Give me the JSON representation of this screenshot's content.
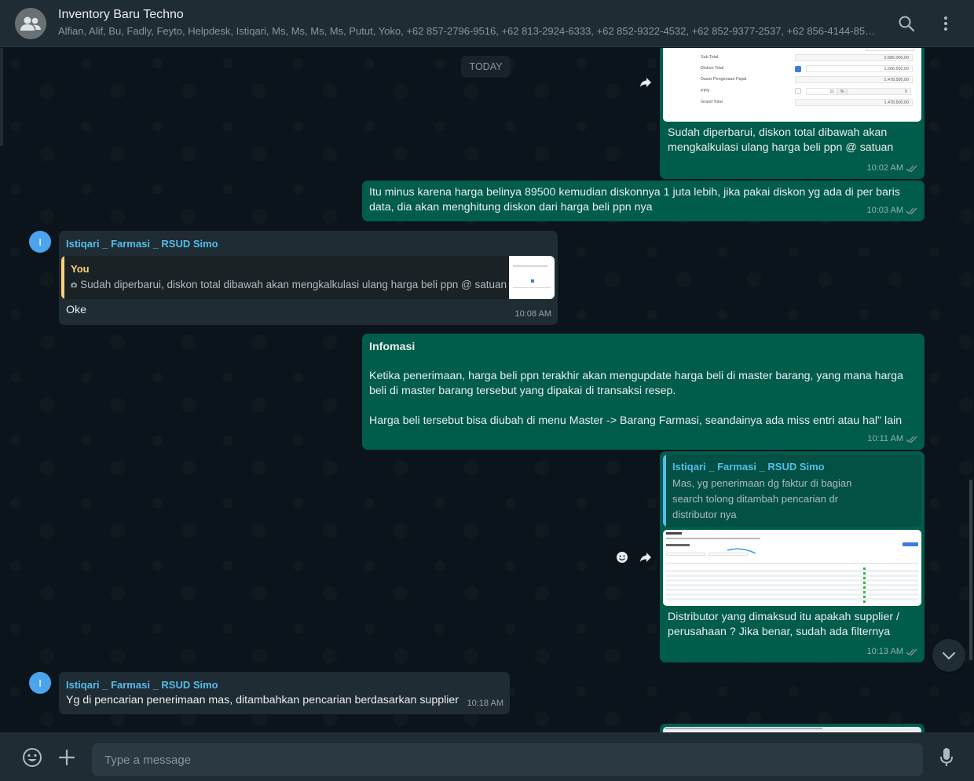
{
  "header": {
    "title": "Inventory Baru Techno",
    "participants": "Alfian, Alif, Bu, Fadly, Feyto, Helpdesk, Istiqari, Ms, Ms, Ms, Ms, Putut, Yoko, +62 857-2796-9516, +62 813-2924-6333, +62 852-9322-4532, +62 852-9377-2537, +62 856-4144-850..."
  },
  "chat": {
    "date_label": "TODAY",
    "messages": [
      {
        "text": "Sudah diperbarui, diskon total dibawah akan mengkalkulasi ulang harga beli ppn @ satuan",
        "time": "10:02 AM",
        "image_rows": [
          {
            "label": "Sub Total",
            "value": "2.685.000,00"
          },
          {
            "label": "Diskon Total",
            "value": "1.206.500,00"
          },
          {
            "label": "Dasar Pengenaan Pajak",
            "value": "1.478.500,00"
          },
          {
            "label": "PPN",
            "value": "0",
            "pct": "11",
            "pct_sign": "%"
          },
          {
            "label": "Grand Total",
            "value": "1.478.500,00"
          }
        ]
      },
      {
        "text": "Itu minus karena harga belinya 89500 kemudian diskonnya 1 juta lebih, jika pakai diskon yg ada di per baris data, dia akan menghitung diskon dari harga beli ppn nya",
        "time": "10:03 AM"
      },
      {
        "avatar_letter": "I",
        "sender": "Istiqari _ Farmasi _ RSUD Simo",
        "quote_author": "You",
        "quote_text": "Sudah diperbarui, diskon total dibawah akan mengkalkulasi ulang harga beli ppn @ satuan",
        "text": "Oke",
        "time": "10:08 AM"
      },
      {
        "title": "Infomasi",
        "paragraph1": "Ketika penerimaan, harga beli ppn terakhir akan mengupdate harga beli di master barang, yang mana harga beli di master barang tersebut yang dipakai di transaksi resep.",
        "paragraph2": "Harga beli tersebut bisa diubah di menu Master -> Barang Farmasi, seandainya ada miss entri atau hal\" lain",
        "time": "10:11 AM"
      },
      {
        "quote_author": "Istiqari _ Farmasi _ RSUD Simo",
        "quote_text": "Mas, yg penerimaan dg faktur di bagian search tolong ditambah pencarian dr distributor nya",
        "text": "Distributor yang dimaksud itu apakah supplier / perusahaan ? Jika benar, sudah ada filternya",
        "time": "10:13 AM"
      },
      {
        "avatar_letter": "I",
        "sender": "Istiqari _ Farmasi _ RSUD Simo",
        "text": "Yg di pencarian penerimaan mas, ditambahkan pencarian berdasarkan supplier",
        "time": "10:18 AM"
      }
    ]
  },
  "composer": {
    "placeholder": "Type a message"
  },
  "colors": {
    "outgoing_bubble": "#005c4b",
    "incoming_bubble": "#202c33",
    "background": "#0b141a",
    "sender_name": "#53bdeb",
    "quote_you": "#ffd279"
  }
}
